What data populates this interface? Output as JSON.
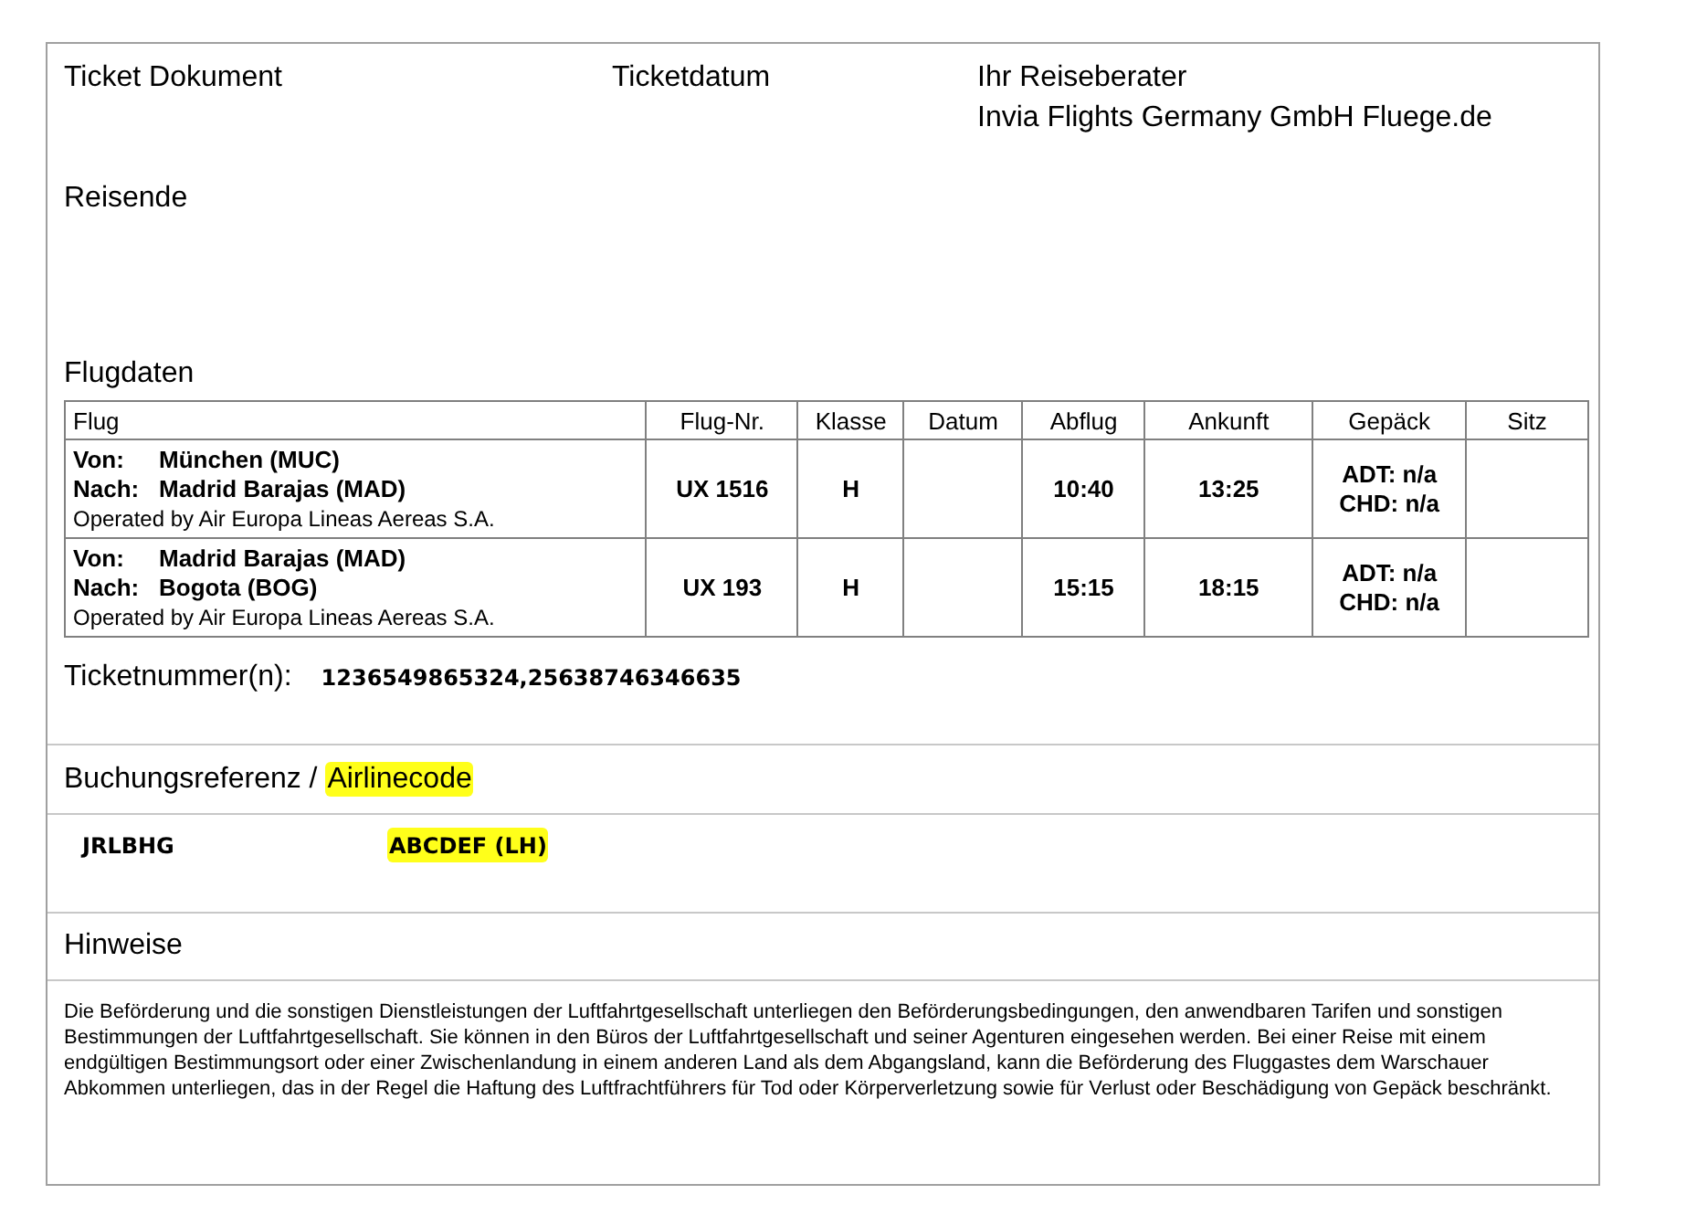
{
  "header": {
    "title": "Ticket Dokument",
    "date_label": "Ticketdatum",
    "advisor_label": "Ihr Reiseberater",
    "advisor_name": "Invia Flights Germany GmbH Fluege.de"
  },
  "passengers": {
    "title": "Reisende"
  },
  "flights": {
    "title": "Flugdaten",
    "columns": [
      "Flug",
      "Flug-Nr.",
      "Klasse",
      "Datum",
      "Abflug",
      "Ankunft",
      "Gepäck",
      "Sitz"
    ],
    "rows": [
      {
        "from_label": "Von:",
        "from": "München (MUC)",
        "to_label": "Nach:",
        "to": "Madrid Barajas (MAD)",
        "operator": "Operated by Air Europa Lineas Aereas S.A.",
        "number": "UX 1516",
        "class": "H",
        "departure": "10:40",
        "arrival": "13:25",
        "baggage": [
          "ADT: n/a",
          "CHD: n/a"
        ]
      },
      {
        "from_label": "Von:",
        "from": "Madrid Barajas (MAD)",
        "to_label": "Nach:",
        "to": "Bogota (BOG)",
        "operator": "Operated by Air Europa Lineas Aereas S.A.",
        "number": "UX 193",
        "class": "H",
        "departure": "15:15",
        "arrival": "18:15",
        "baggage": [
          "ADT: n/a",
          "CHD: n/a"
        ]
      }
    ]
  },
  "ticket_numbers": {
    "label": "Ticketnummer(n):",
    "value": "1236549865324,25638746346635"
  },
  "booking": {
    "title_parts": [
      {
        "text": "Buchungsreferenz /",
        "highlighted": false
      },
      {
        "text": "Airlinecode",
        "highlighted": true
      }
    ],
    "values": [
      {
        "text": "JRLBHG",
        "highlighted": false
      },
      {
        "text": "ABCDEF (LH)",
        "highlighted": true
      }
    ]
  },
  "notes": {
    "title": "Hinweise",
    "text": "Die Beförderung und die sonstigen Dienstleistungen der Luftfahrtgesellschaft unterliegen den Beförderungsbedingungen, den anwendbaren Tarifen und sonstigen Bestimmungen der Luftfahrtgesellschaft. Sie können in den Büros der Luftfahrtgesellschaft und seiner Agenturen eingesehen werden. Bei einer Reise mit einem endgültigen Bestimmungsort oder einer Zwischenlandung in einem anderen Land als dem Abgangsland, kann die Beförderung des Fluggastes dem Warschauer Abkommen unterliegen, das in der Regel die Haftung des Luftfrachtführers für Tod oder Körperverletzung sowie für Verlust oder Beschädigung von Gepäck beschränkt."
  }
}
